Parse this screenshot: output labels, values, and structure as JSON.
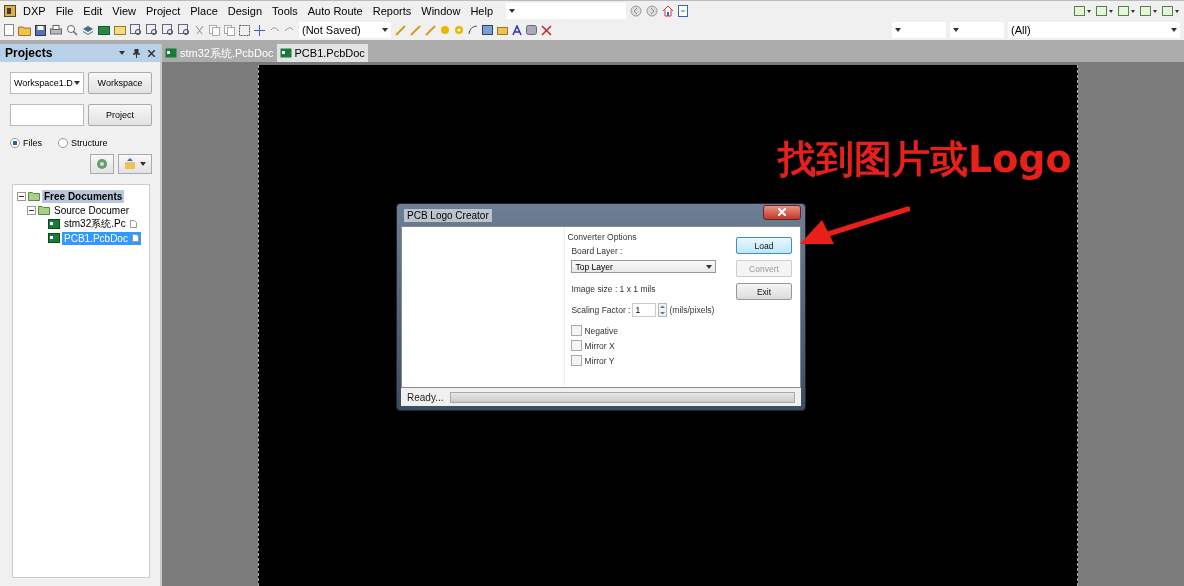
{
  "menu": {
    "items": [
      "DXP",
      "File",
      "Edit",
      "View",
      "Project",
      "Place",
      "Design",
      "Tools",
      "Auto Route",
      "Reports",
      "Window",
      "Help"
    ]
  },
  "toolbar": {
    "variant_dropdown": "(Not Saved)",
    "filter_dropdown": "(All)"
  },
  "projects_panel": {
    "title": "Projects",
    "workspace_dropdown": "Workspace1.D",
    "workspace_button": "Workspace",
    "project_button": "Project",
    "view_options": [
      {
        "label": "Files",
        "selected": true
      },
      {
        "label": "Structure",
        "selected": false
      }
    ],
    "tree": [
      {
        "label": "Free Documents",
        "kind": "folder",
        "expanded": true,
        "selected": false,
        "children": [
          {
            "label": "Source Documer",
            "kind": "folder",
            "expanded": true,
            "selected": false,
            "children": [
              {
                "label": "stm32系统.Pc",
                "kind": "pcb",
                "selected": false
              },
              {
                "label": "PCB1.PcbDoc",
                "kind": "pcb",
                "selected": true
              }
            ]
          }
        ]
      }
    ]
  },
  "document_tabs": [
    {
      "label": "stm32系统.PcbDoc",
      "selected": false
    },
    {
      "label": "PCB1.PcbDoc",
      "selected": true
    }
  ],
  "dialog": {
    "title": "PCB Logo Creator",
    "group_title": "Converter Options",
    "board_layer_label": "Board Layer :",
    "board_layer_value": "Top Layer",
    "image_size": "Image size : 1 x 1 mils",
    "scaling_label": "Scaling Factor :",
    "scaling_value": "1",
    "scaling_unit": "(mils/pixels)",
    "options": [
      {
        "label": "Negative",
        "checked": false
      },
      {
        "label": "Mirror X",
        "checked": false
      },
      {
        "label": "Mirror Y",
        "checked": false
      }
    ],
    "buttons": [
      {
        "label": "Load",
        "disabled": false,
        "focused": true
      },
      {
        "label": "Convert",
        "disabled": true,
        "focused": false
      },
      {
        "label": "Exit",
        "disabled": false,
        "focused": false
      }
    ],
    "status": "Ready...",
    "progress": {
      "level": 0
    }
  },
  "annotation": {
    "text": "找到图片或Logo"
  }
}
